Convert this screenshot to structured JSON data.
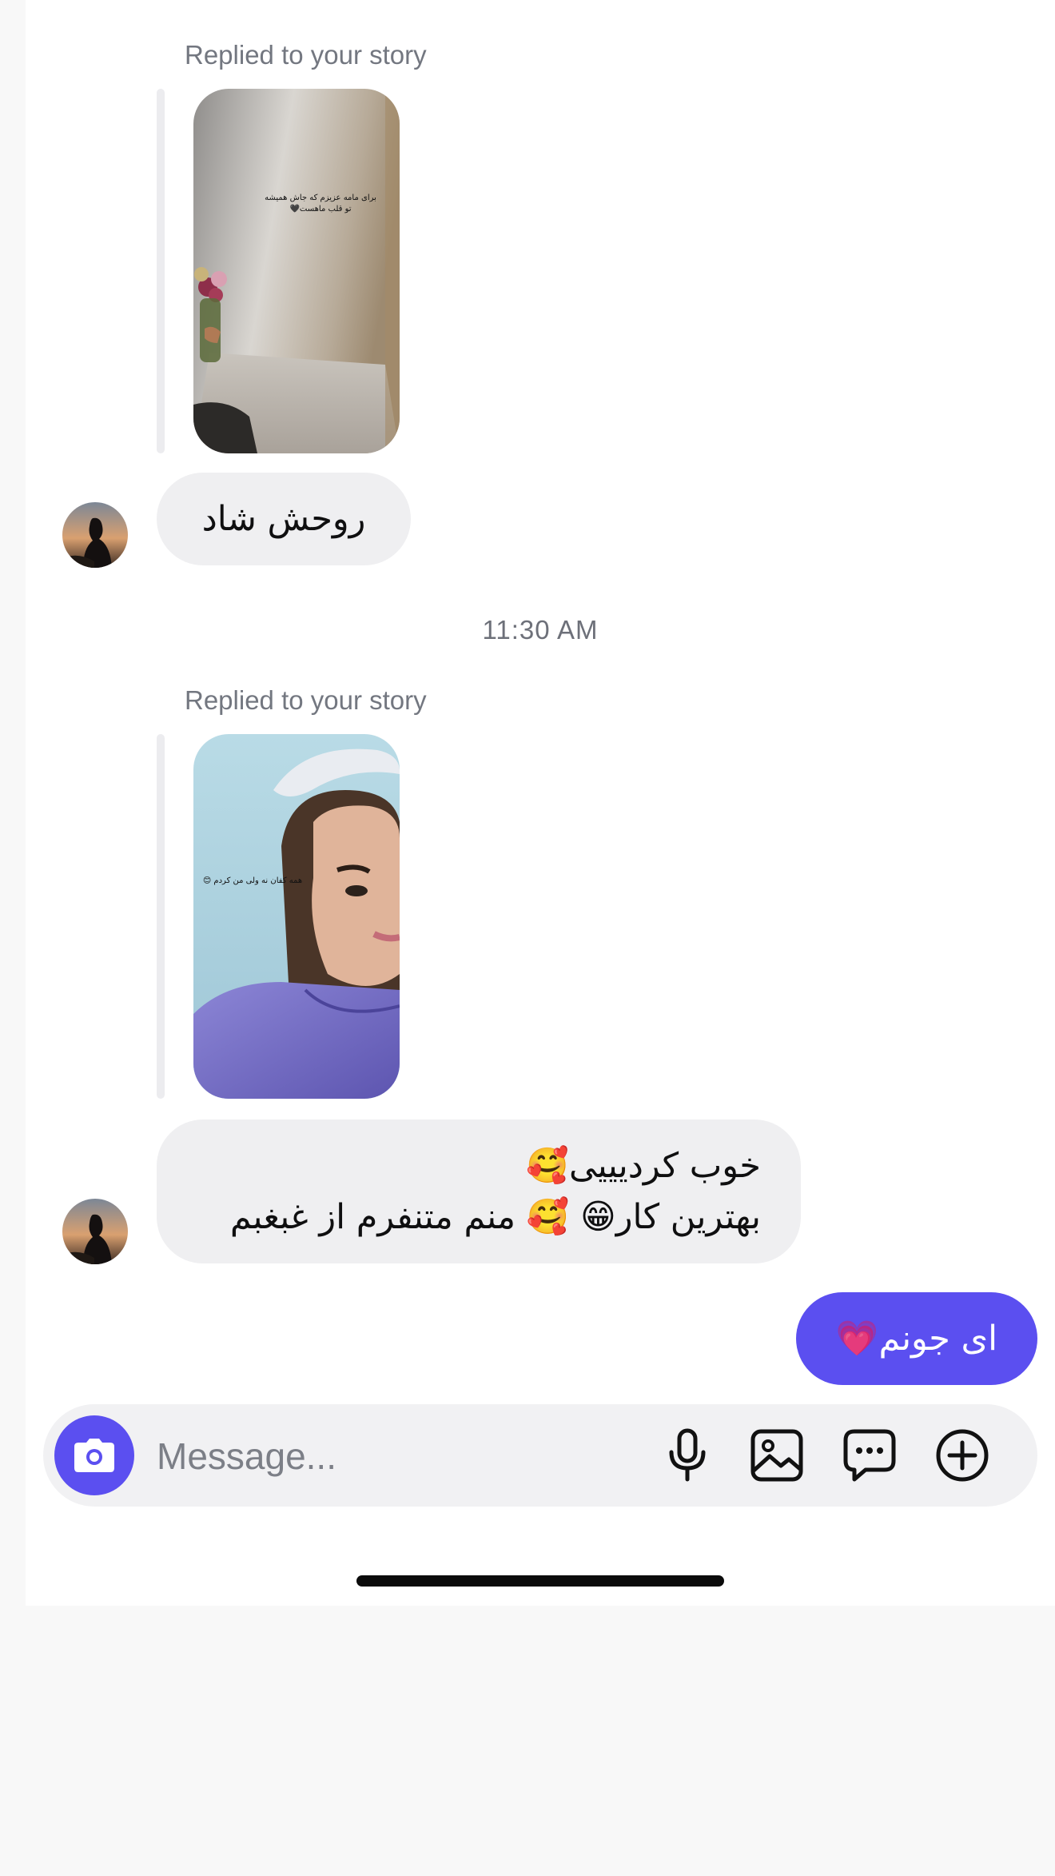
{
  "thread": {
    "messages": [
      {
        "type": "story_reply",
        "caption": "Replied to your story",
        "story_overlay_text": "برای مامه عزیزم که جاش همیشه\nتو قلب ماهست🖤",
        "reply_text": "روحش شاد"
      },
      {
        "type": "timestamp",
        "text": "11:30 AM"
      },
      {
        "type": "story_reply",
        "caption": "Replied to your story",
        "story_overlay_text": "همه کفان نه ولی من کردم 😊",
        "reply_line1": "خوب کردیییی🥰",
        "reply_line2": "بهترین کار😁 🥰 منم متنفرم از غبغبم"
      },
      {
        "type": "outgoing",
        "text": "ای جونم💗"
      }
    ]
  },
  "composer": {
    "placeholder": "Message...",
    "icons": [
      "camera-icon",
      "microphone-icon",
      "gallery-icon",
      "sticker-chat-icon",
      "plus-circle-icon"
    ]
  },
  "colors": {
    "accent": "#5b4ff0",
    "incoming_bubble": "#efeff1",
    "caption": "#737780"
  }
}
